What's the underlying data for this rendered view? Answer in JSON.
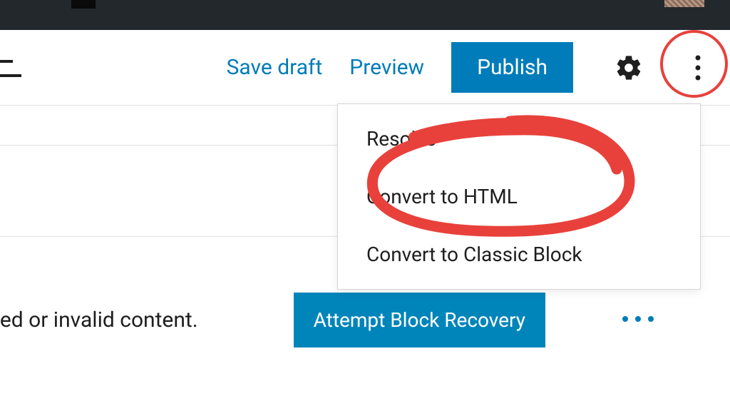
{
  "toolbar": {
    "save_draft": "Save draft",
    "preview": "Preview",
    "publish": "Publish"
  },
  "dropdown": {
    "items": [
      "Resolve",
      "Convert to HTML",
      "Convert to Classic Block"
    ]
  },
  "content": {
    "error_text_fragment": "ted or invalid content.",
    "recovery_button": "Attempt Block Recovery"
  }
}
